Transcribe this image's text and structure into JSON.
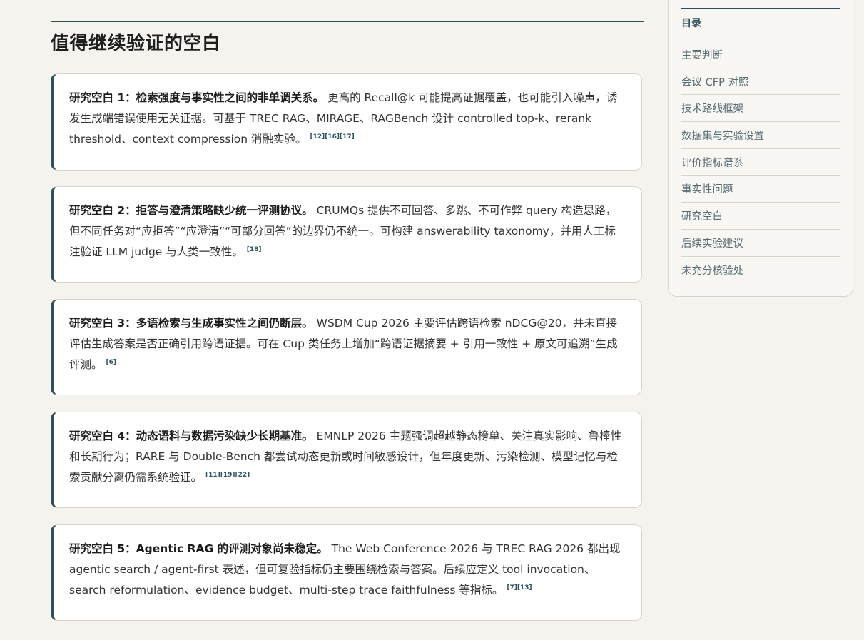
{
  "section": {
    "title": "值得继续验证的空白"
  },
  "gaps": [
    {
      "lead": "研究空白 1：检索强度与事实性之间的非单调关系。",
      "body": "更高的 Recall@k 可能提高证据覆盖，也可能引入噪声，诱发生成端错误使用无关证据。可基于 TREC RAG、MIRAGE、RAGBench 设计 controlled top-k、rerank threshold、context compression 消融实验。",
      "refs": "[12][16][17]"
    },
    {
      "lead": "研究空白 2：拒答与澄清策略缺少统一评测协议。",
      "body": "CRUMQs 提供不可回答、多跳、不可作弊 query 构造思路，但不同任务对“应拒答”“应澄清”“可部分回答”的边界仍不统一。可构建 answerability taxonomy，并用人工标注验证 LLM judge 与人类一致性。",
      "refs": "[18]"
    },
    {
      "lead": "研究空白 3：多语检索与生成事实性之间仍断层。",
      "body": "WSDM Cup 2026 主要评估跨语检索 nDCG@20，并未直接评估生成答案是否正确引用跨语证据。可在 Cup 类任务上增加“跨语证据摘要 + 引用一致性 + 原文可追溯”生成评测。",
      "refs": "[6]"
    },
    {
      "lead": "研究空白 4：动态语料与数据污染缺少长期基准。",
      "body": "EMNLP 2026 主题强调超越静态榜单、关注真实影响、鲁棒性和长期行为；RARE 与 Double-Bench 都尝试动态更新或时间敏感设计，但年度更新、污染检测、模型记忆与检索贡献分离仍需系统验证。",
      "refs": "[11][19][22]"
    },
    {
      "lead": "研究空白 5：Agentic RAG 的评测对象尚未稳定。",
      "body": "The Web Conference 2026 与 TREC RAG 2026 都出现 agentic search / agent-first 表述，但可复验指标仍主要围绕检索与答案。后续应定义 tool invocation、search reformulation、evidence budget、multi-step trace faithfulness 等指标。",
      "refs": "[7][13]"
    }
  ],
  "toc": {
    "title": "目录",
    "items": [
      "主要判断",
      "会议 CFP 对照",
      "技术路线框架",
      "数据集与实验设置",
      "评价指标谱系",
      "事实性问题",
      "研究空白",
      "后续实验建议",
      "未充分核验处"
    ]
  }
}
